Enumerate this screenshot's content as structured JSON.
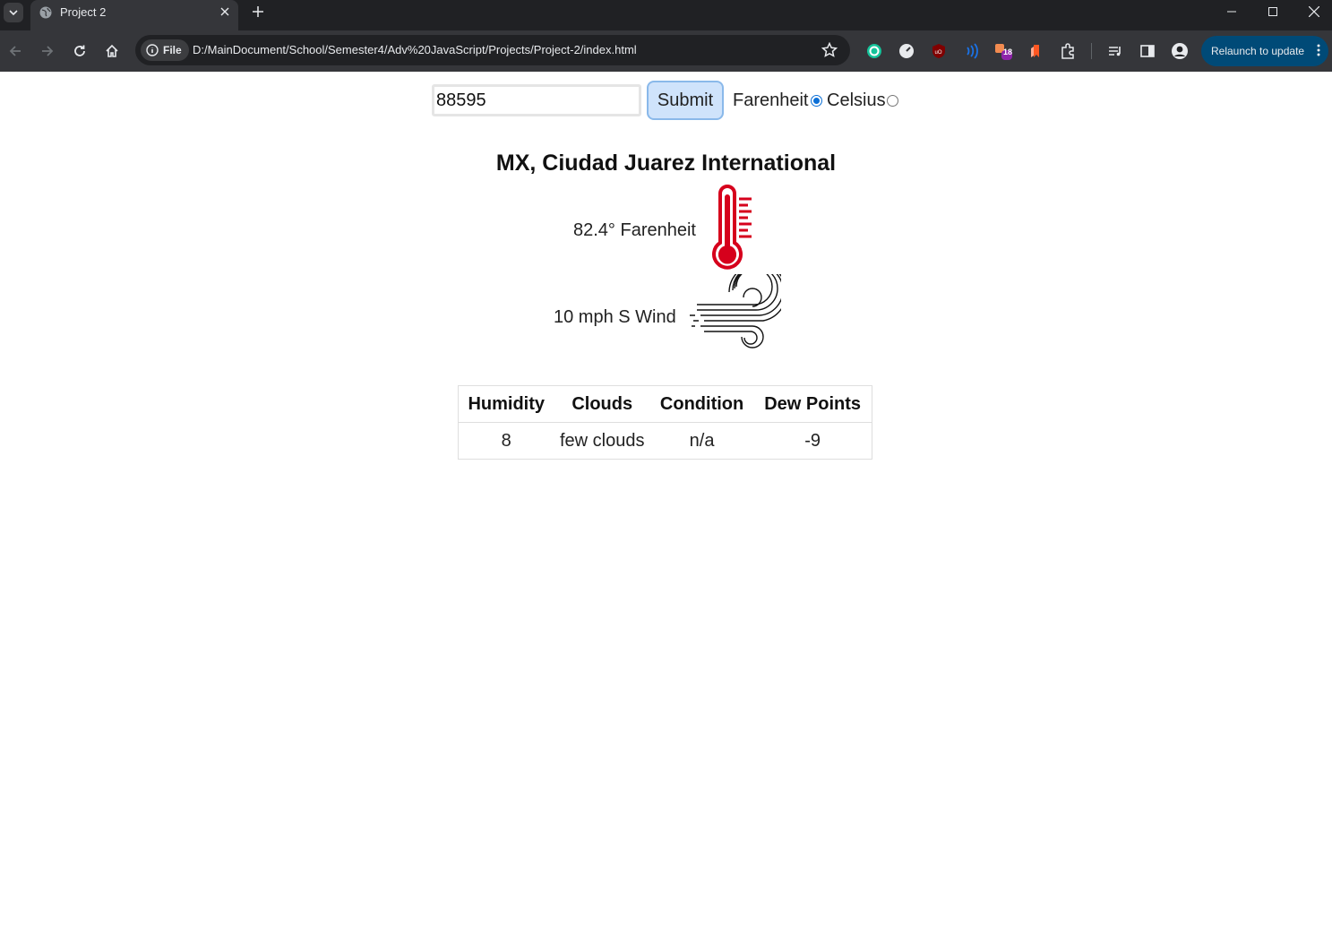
{
  "browser": {
    "tab_title": "Project 2",
    "file_chip": "File",
    "url": "D:/MainDocument/School/Semester4/Adv%20JavaScript/Projects/Project-2/index.html",
    "relaunch_label": "Relaunch to update",
    "extension_badge": "18"
  },
  "form": {
    "zip_value": "88595",
    "submit_label": "Submit",
    "unit_fahrenheit": "Farenheit",
    "unit_celsius": "Celsius",
    "selected_unit": "Farenheit"
  },
  "weather": {
    "station": "MX, Ciudad Juarez International",
    "temperature_text": "82.4° Farenheit",
    "wind_text": "10 mph S Wind",
    "icons": [
      "thermometer-icon",
      "wind-icon"
    ],
    "thermometer_color": "#d6001c",
    "table": {
      "headers": [
        "Humidity",
        "Clouds",
        "Condition",
        "Dew Points"
      ],
      "row": [
        "8",
        "few clouds",
        "n/a",
        "-9"
      ]
    }
  }
}
